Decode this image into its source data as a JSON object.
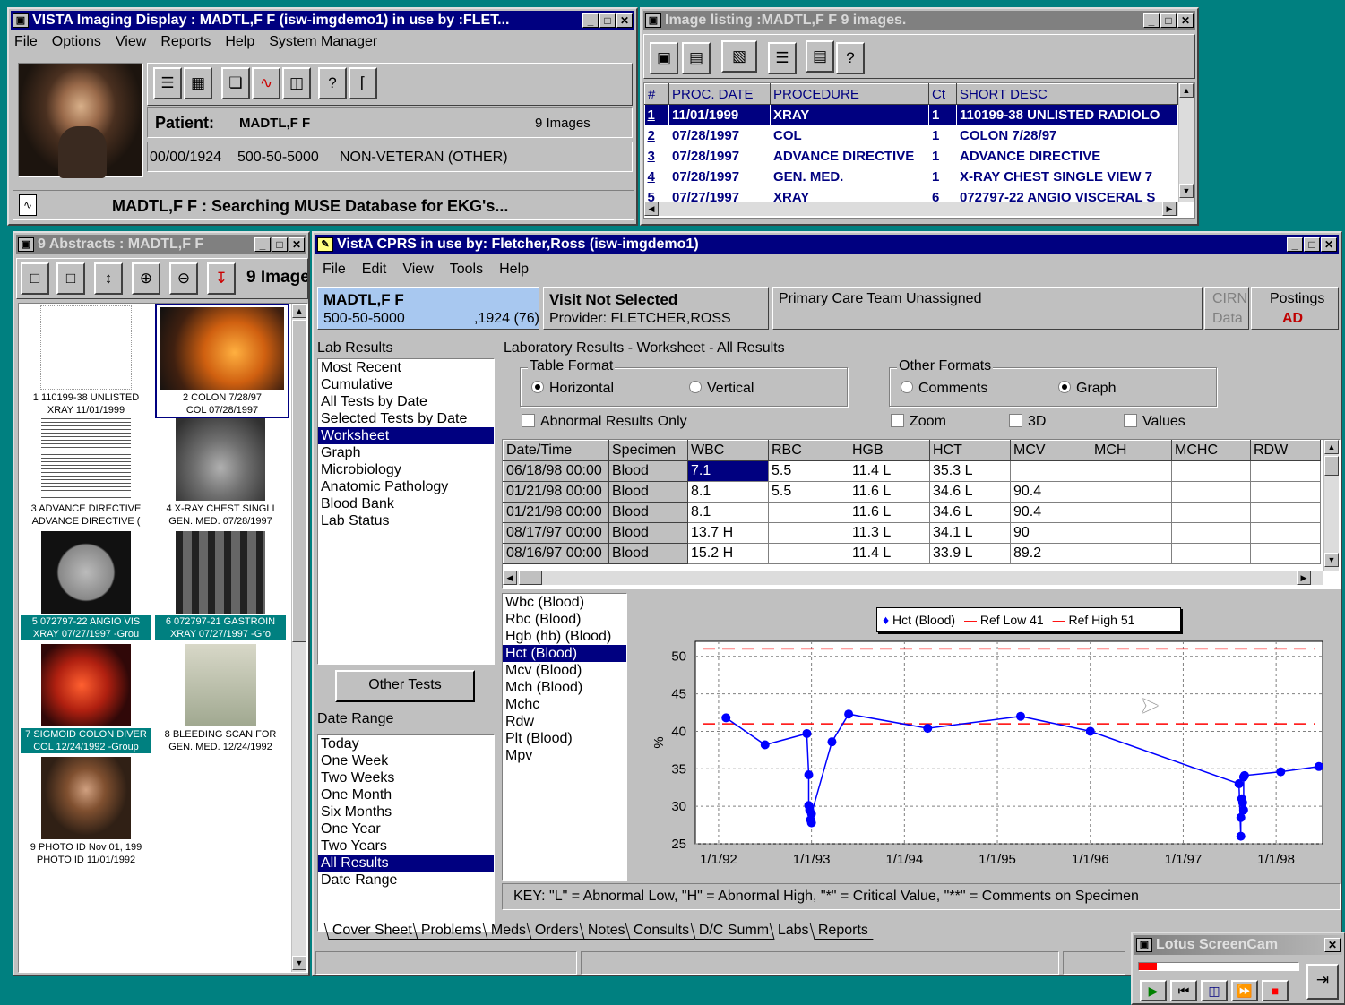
{
  "imaging": {
    "title": "VISTA Imaging Display : MADTL,F F  (isw-imgdemo1) in use by :FLET...",
    "menu": [
      "File",
      "Options",
      "View",
      "Reports",
      "Help",
      "System Manager"
    ],
    "patient_label": "Patient:",
    "patient_name": "MADTL,F F",
    "image_count": "9  Images",
    "dob": "00/00/1924",
    "ssn": "500-50-5000",
    "status": "NON-VETERAN (OTHER)",
    "message": "MADTL,F F : Searching MUSE Database for EKG's..."
  },
  "image_listing": {
    "title": "Image listing :MADTL,F F 9 images.",
    "columns": [
      "#",
      "PROC. DATE",
      "PROCEDURE",
      "Ct",
      "SHORT DESC"
    ],
    "rows": [
      [
        "1",
        "11/01/1999",
        "XRAY",
        "1",
        "110199-38  UNLISTED RADIOLO"
      ],
      [
        "2",
        "07/28/1997",
        "COL",
        "1",
        "COLON  7/28/97"
      ],
      [
        "3",
        "07/28/1997",
        "ADVANCE DIRECTIVE",
        "1",
        "ADVANCE DIRECTIVE"
      ],
      [
        "4",
        "07/28/1997",
        "GEN. MED.",
        "1",
        "X-RAY  CHEST SINGLE VIEW  7"
      ],
      [
        "5",
        "07/27/1997",
        "XRAY",
        "6",
        "072797-22  ANGIO VISCERAL S"
      ]
    ]
  },
  "abstracts": {
    "title": "9  Abstracts : MADTL,F F",
    "image_label": "9 Image",
    "items": [
      {
        "l1": "1 110199-38  UNLISTED",
        "l2": "XRAY  11/01/1999"
      },
      {
        "l1": "2 COLON  7/28/97",
        "l2": "COL  07/28/1997"
      },
      {
        "l1": "3 ADVANCE DIRECTIVE",
        "l2": "ADVANCE DIRECTIVE  ("
      },
      {
        "l1": "4 X-RAY  CHEST SINGLI",
        "l2": "GEN. MED.  07/28/1997"
      },
      {
        "l1": "5 072797-22  ANGIO VIS",
        "l2": "XRAY  07/27/1997 -Grou"
      },
      {
        "l1": "6 072797-21  GASTROIN",
        "l2": "XRAY  07/27/1997 -Gro"
      },
      {
        "l1": "7 SIGMOID COLON DIVER",
        "l2": "COL  12/24/1992 -Group"
      },
      {
        "l1": "8 BLEEDING SCAN FOR",
        "l2": "GEN. MED.  12/24/1992"
      },
      {
        "l1": "9 PHOTO ID Nov 01, 199",
        "l2": "PHOTO ID  11/01/1992"
      }
    ]
  },
  "cprs": {
    "title": "VistA CPRS in use by: Fletcher,Ross  (isw-imgdemo1)",
    "menu": [
      "File",
      "Edit",
      "View",
      "Tools",
      "Help"
    ],
    "patient_name": "MADTL,F F",
    "patient_ssn": "500-50-5000",
    "patient_dob": ",1924 (76)",
    "visit": "Visit Not Selected",
    "provider": "Provider:  FLETCHER,ROSS",
    "care_team": "Primary Care Team Unassigned",
    "cirn1": "CIRN",
    "cirn2": "Data",
    "postings": "Postings",
    "postings_val": "AD",
    "lab_results_label": "Lab Results",
    "lab_types": [
      "Most Recent",
      "Cumulative",
      "All Tests by Date",
      "Selected Tests by Date",
      "Worksheet",
      "Graph",
      "Microbiology",
      "Anatomic Pathology",
      "Blood Bank",
      "Lab Status"
    ],
    "lab_types_selected": 4,
    "other_tests": "Other Tests",
    "date_range_label": "Date Range",
    "date_ranges": [
      "Today",
      "One Week",
      "Two Weeks",
      "One Month",
      "Six Months",
      "One Year",
      "Two Years",
      "All Results",
      "Date Range"
    ],
    "date_ranges_selected": 7,
    "worksheet_title": "Laboratory Results - Worksheet - All Results",
    "table_format_label": "Table Format",
    "horizontal": "Horizontal",
    "vertical": "Vertical",
    "other_formats_label": "Other Formats",
    "comments": "Comments",
    "graph": "Graph",
    "abnormal_only": "Abnormal Results Only",
    "zoom": "Zoom",
    "three_d": "3D",
    "values": "Values",
    "grid_columns": [
      "Date/Time",
      "Specimen",
      "WBC",
      "RBC",
      "HGB",
      "HCT",
      "MCV",
      "MCH",
      "MCHC",
      "RDW"
    ],
    "grid_rows": [
      [
        "06/18/98 00:00",
        "Blood",
        "7.1",
        "5.5",
        "11.4 L",
        "35.3 L",
        "",
        "",
        "",
        ""
      ],
      [
        "01/21/98 00:00",
        "Blood",
        "8.1",
        "5.5",
        "11.6 L",
        "34.6 L",
        "90.4",
        "",
        "",
        ""
      ],
      [
        "01/21/98 00:00",
        "Blood",
        "8.1",
        "",
        "11.6 L",
        "34.6 L",
        "90.4",
        "",
        "",
        ""
      ],
      [
        "08/17/97 00:00",
        "Blood",
        "13.7 H",
        "",
        "11.3 L",
        "34.1 L",
        "90",
        "",
        "",
        ""
      ],
      [
        "08/16/97 00:00",
        "Blood",
        "15.2 H",
        "",
        "11.4 L",
        "33.9 L",
        "89.2",
        "",
        "",
        ""
      ]
    ],
    "tests": [
      "Wbc (Blood)",
      "Rbc (Blood)",
      "Hgb (hb) (Blood)",
      "Hct (Blood)",
      "Mcv (Blood)",
      "Mch (Blood)",
      "Mchc",
      "Rdw",
      "Plt  (Blood)",
      "Mpv"
    ],
    "tests_selected": 3,
    "key": "KEY: \"L\" = Abnormal Low, \"H\" = Abnormal High, \"*\" = Critical Value, \"**\" = Comments on Specimen",
    "tabs": [
      "Cover Sheet",
      "Problems",
      "Meds",
      "Orders",
      "Notes",
      "Consults",
      "D/C Summ",
      "Labs",
      "Reports"
    ],
    "tabs_selected": 7
  },
  "chart_data": {
    "type": "line",
    "ylabel": "%",
    "ylim": [
      25,
      52
    ],
    "yticks": [
      25,
      30,
      35,
      40,
      45,
      50
    ],
    "xtick_labels": [
      "1/1/92",
      "1/1/93",
      "1/1/94",
      "1/1/95",
      "1/1/96",
      "1/1/97",
      "1/1/98"
    ],
    "xlim": [
      1991.75,
      1998.5
    ],
    "grid": true,
    "legend_position": "top",
    "legend": [
      "Hct (Blood)",
      "Ref Low 41",
      "Ref High 51"
    ],
    "ref_low": 41,
    "ref_high": 51,
    "colors": {
      "series": "#0000ff",
      "ref": "#ff0000"
    },
    "series": [
      {
        "name": "Hct (Blood)",
        "x": [
          1992.08,
          1992.5,
          1992.95,
          1992.97,
          1992.97,
          1992.98,
          1992.99,
          1993.0,
          1993.0,
          1993.22,
          1993.4,
          1994.25,
          1995.25,
          1996.0,
          1997.6,
          1997.62,
          1997.62,
          1997.63,
          1997.64,
          1997.65,
          1997.65,
          1997.66,
          1998.05,
          1998.46
        ],
        "y": [
          41.8,
          38.2,
          39.7,
          34.2,
          30.1,
          29.5,
          28.2,
          27.8,
          29.0,
          38.6,
          42.3,
          40.4,
          42.0,
          40.0,
          33.0,
          26.0,
          28.5,
          31.0,
          30.5,
          29.5,
          33.9,
          34.1,
          34.6,
          35.3
        ]
      }
    ]
  },
  "screencam": {
    "title": "Lotus ScreenCam"
  }
}
